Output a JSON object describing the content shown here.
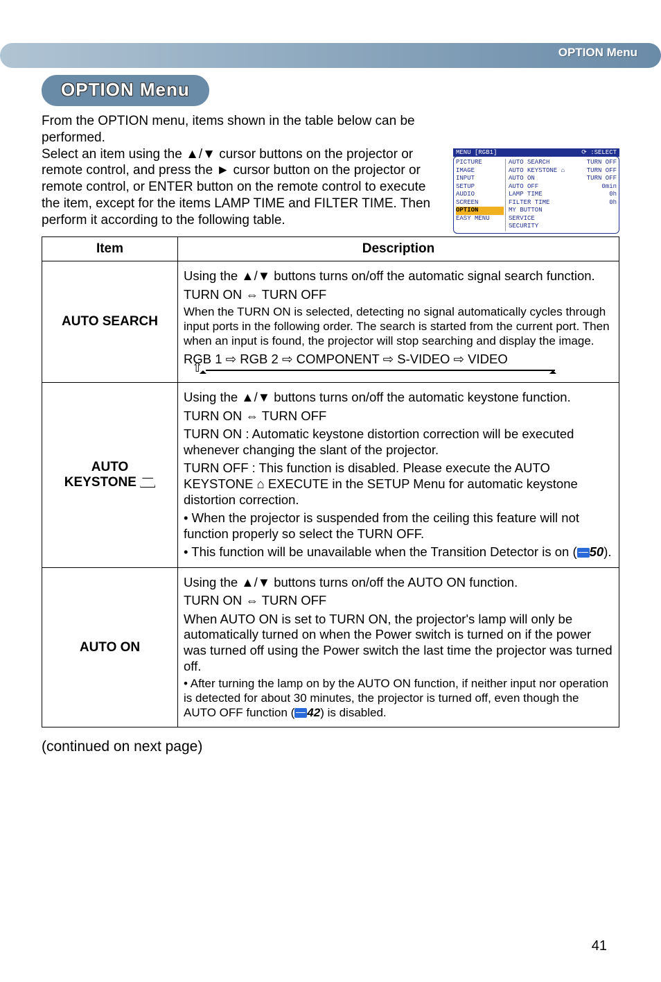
{
  "header_tab": "OPTION Menu",
  "title": "OPTION Menu",
  "intro": "From the OPTION menu, items shown in the table below can be performed.\nSelect an item using the ▲/▼ cursor buttons on the projector or remote control, and press the ► cursor button on the projector or remote control, or ENTER button on the remote control to execute the item, except for the items LAMP TIME and FILTER TIME. Then perform it according to the following table.",
  "osd": {
    "title_left": "MENU [RGB1]",
    "title_right": "⟳ :SELECT",
    "left_items": [
      "PICTURE",
      "IMAGE",
      "INPUT",
      "SETUP",
      "AUDIO",
      "SCREEN",
      "OPTION",
      "EASY MENU"
    ],
    "highlight_index": 6,
    "right_rows": [
      {
        "label": "AUTO SEARCH",
        "value": "TURN OFF"
      },
      {
        "label": "AUTO KEYSTONE ⌂",
        "value": "TURN OFF"
      },
      {
        "label": "AUTO ON",
        "value": "TURN OFF"
      },
      {
        "label": "AUTO OFF",
        "value": "0min"
      },
      {
        "label": "LAMP TIME",
        "value": "0h"
      },
      {
        "label": "FILTER TIME",
        "value": "0h"
      },
      {
        "label": "MY BUTTON",
        "value": ""
      },
      {
        "label": "SERVICE",
        "value": ""
      },
      {
        "label": "SECURITY",
        "value": ""
      }
    ]
  },
  "table": {
    "head_item": "Item",
    "head_desc": "Description",
    "rows": [
      {
        "item": "AUTO SEARCH",
        "desc_p1": "Using the ▲/▼ buttons turns on/off the automatic signal search function.",
        "desc_toggle": "TURN ON ⇔ TURN OFF",
        "desc_p2": "When the TURN ON is selected, detecting no signal automatically cycles through input ports in the following order. The search is started from the current port. Then when an input is found, the projector will stop searching and display the image.",
        "desc_chain": "RGB 1 ⇨ RGB 2 ⇨ COMPONENT ⇨ S-VIDEO ⇨ VIDEO"
      },
      {
        "item_line1": "AUTO",
        "item_line2": "KEYSTONE",
        "desc_p1": "Using the ▲/▼ buttons turns on/off the automatic keystone function.",
        "desc_toggle": "TURN ON ⇔ TURN OFF",
        "desc_on": "TURN ON : Automatic keystone distortion correction will be executed whenever changing the slant of the projector.",
        "desc_off": "TURN OFF : This function is disabled. Please execute the AUTO KEYSTONE ⌂ EXECUTE in the SETUP Menu for automatic keystone distortion correction.",
        "desc_b1": "• When the projector is suspended from the ceiling this feature will not function properly so select the TURN OFF.",
        "desc_b2_pre": "• This function will be unavailable when the Transition Detector is on (",
        "desc_b2_ref": "50",
        "desc_b2_post": ")."
      },
      {
        "item": "AUTO ON",
        "desc_p1": "Using the ▲/▼ buttons turns on/off the AUTO ON function.",
        "desc_toggle": "TURN ON ⇔ TURN OFF",
        "desc_p2": "When AUTO ON is set to TURN ON, the projector's lamp will only be automatically turned on when the Power switch is turned on if the power was turned off using the Power switch the last time the projector was turned off.",
        "desc_b1_pre": "• After turning the lamp on by the AUTO ON function, if neither input nor operation is detected for about 30 minutes, the projector is turned off, even though the AUTO OFF function (",
        "desc_b1_ref": "42",
        "desc_b1_post": ") is disabled."
      }
    ]
  },
  "continued": "(continued on next page)",
  "page_number": "41"
}
